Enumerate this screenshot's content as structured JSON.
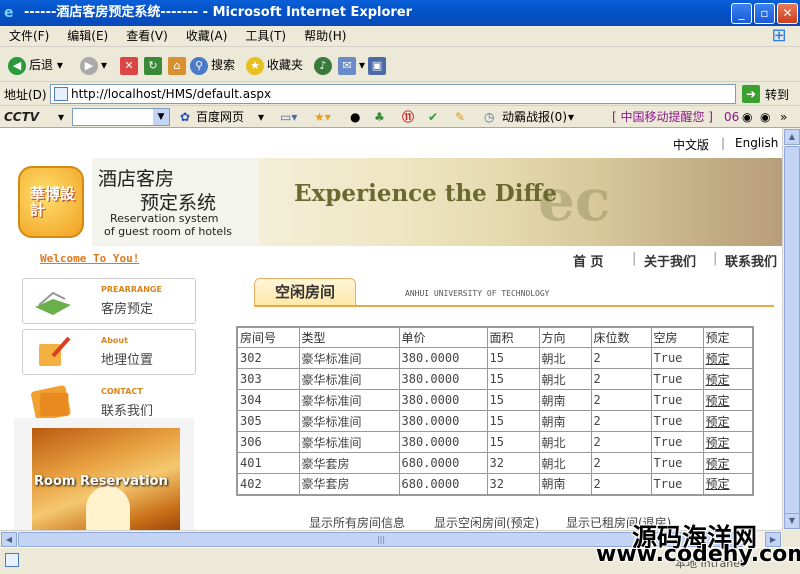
{
  "window": {
    "title": "------酒店客房预定系统------- - Microsoft Internet Explorer"
  },
  "menu": [
    "文件(F)",
    "编辑(E)",
    "查看(V)",
    "收藏(A)",
    "工具(T)",
    "帮助(H)"
  ],
  "toolbar": {
    "back": "后退",
    "search": "搜索",
    "favorites": "收藏夹"
  },
  "address": {
    "label": "地址(D)",
    "url": "http://localhost/HMS/default.aspx",
    "go": "转到"
  },
  "cctv": {
    "logo": "CCTV",
    "baidu": "百度网页",
    "news": "动霸战报(0)",
    "mobile": "[ 中国移动提醒您 ]",
    "num": "06"
  },
  "page": {
    "lang_cn": "中文版",
    "lang_sep": "|",
    "lang_en": "English",
    "banner": {
      "t1": "酒店客房",
      "t2": "预定系统",
      "t3": "Reservation system",
      "t4": "of guest room of hotels",
      "logo_text": "華博設計",
      "exp": "Experience the Diffe",
      "ec": "ec"
    },
    "welcome": "Welcome To You!",
    "nav": [
      "首 页",
      "关于我们",
      "联系我们"
    ],
    "nav_sep": "|",
    "side": [
      {
        "en": "PREARRANGE",
        "cn": "客房预定",
        "icon": "book-icon"
      },
      {
        "en": "About",
        "cn": "地理位置",
        "icon": "pencil-icon"
      },
      {
        "en": "CONTACT",
        "cn": "联系我们",
        "icon": "folder-icon"
      }
    ],
    "room_image": "Room Reservation",
    "tab": "空闲房间",
    "univ": "ANHUI UNIVERSITY OF TECHNOLOGY",
    "table": {
      "headers": [
        "房间号",
        "类型",
        "单价",
        "面积",
        "方向",
        "床位数",
        "空房",
        "预定"
      ],
      "rows": [
        [
          "302",
          "豪华标准间",
          "380.0000",
          "15",
          "朝北",
          "2",
          "True",
          "预定"
        ],
        [
          "303",
          "豪华标准间",
          "380.0000",
          "15",
          "朝北",
          "2",
          "True",
          "预定"
        ],
        [
          "304",
          "豪华标准间",
          "380.0000",
          "15",
          "朝南",
          "2",
          "True",
          "预定"
        ],
        [
          "305",
          "豪华标准间",
          "380.0000",
          "15",
          "朝南",
          "2",
          "True",
          "预定"
        ],
        [
          "306",
          "豪华标准间",
          "380.0000",
          "15",
          "朝北",
          "2",
          "True",
          "预定"
        ],
        [
          "401",
          "豪华套房",
          "680.0000",
          "32",
          "朝北",
          "2",
          "True",
          "预定"
        ],
        [
          "402",
          "豪华套房",
          "680.0000",
          "32",
          "朝南",
          "2",
          "True",
          "预定"
        ]
      ]
    },
    "footer_links": [
      "显示所有房间信息",
      "显示空闲房间(预定)",
      "显示已租房间(退房)"
    ]
  },
  "status": {
    "zone": "本地 Intranet"
  },
  "watermark": {
    "cn": "源码海洋网",
    "url": "www.codehy.com"
  }
}
